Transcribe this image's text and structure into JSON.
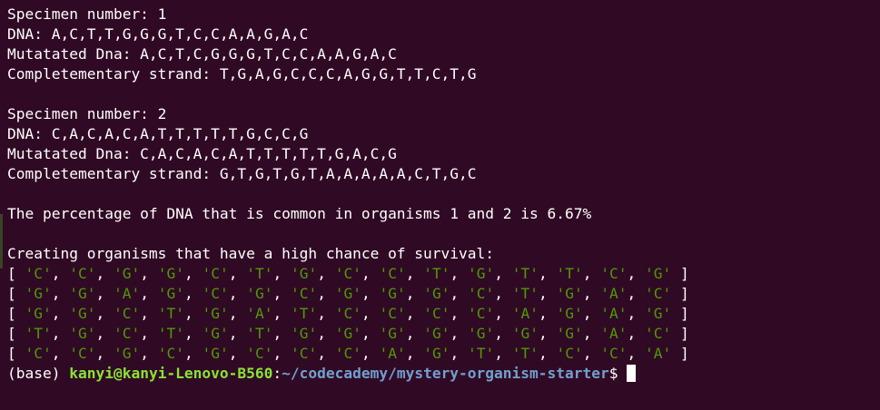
{
  "specimens": [
    {
      "number_line": "Specimen number: 1",
      "dna_line": "DNA: A,C,T,T,G,G,G,T,C,C,A,A,G,A,C",
      "mutated_line": "Mutatated Dna: A,C,T,C,G,G,G,T,C,C,A,A,G,A,C",
      "complement_line": "Completementary strand: T,G,A,G,C,C,C,A,G,G,T,T,C,T,G"
    },
    {
      "number_line": "Specimen number: 2",
      "dna_line": "DNA: C,A,C,A,C,A,T,T,T,T,T,G,C,C,G",
      "mutated_line": "Mutatated Dna: C,A,C,A,C,A,T,T,T,T,T,G,A,C,G",
      "complement_line": "Completementary strand: G,T,G,T,G,T,A,A,A,A,A,C,T,G,C"
    }
  ],
  "percentage_line": "The percentage of DNA that is common in organisms 1 and 2 is 6.67%",
  "survival_header": "Creating organisms that have a high chance of survival:",
  "organisms": [
    [
      "C",
      "C",
      "G",
      "G",
      "C",
      "T",
      "G",
      "C",
      "C",
      "T",
      "G",
      "T",
      "T",
      "C",
      "G"
    ],
    [
      "G",
      "G",
      "A",
      "G",
      "C",
      "G",
      "C",
      "G",
      "G",
      "G",
      "C",
      "T",
      "G",
      "A",
      "C"
    ],
    [
      "G",
      "G",
      "C",
      "T",
      "G",
      "A",
      "T",
      "C",
      "C",
      "C",
      "C",
      "A",
      "G",
      "A",
      "G"
    ],
    [
      "T",
      "G",
      "C",
      "T",
      "G",
      "T",
      "G",
      "G",
      "G",
      "G",
      "G",
      "G",
      "G",
      "A",
      "C"
    ],
    [
      "C",
      "C",
      "G",
      "C",
      "G",
      "C",
      "C",
      "C",
      "A",
      "G",
      "T",
      "T",
      "C",
      "C",
      "A"
    ]
  ],
  "prompt": {
    "env": "(base) ",
    "user_host": "kanyi@kanyi-Lenovo-B560",
    "colon": ":",
    "path": "~/codecademy/mystery-organism-starter",
    "symbol": "$ "
  }
}
